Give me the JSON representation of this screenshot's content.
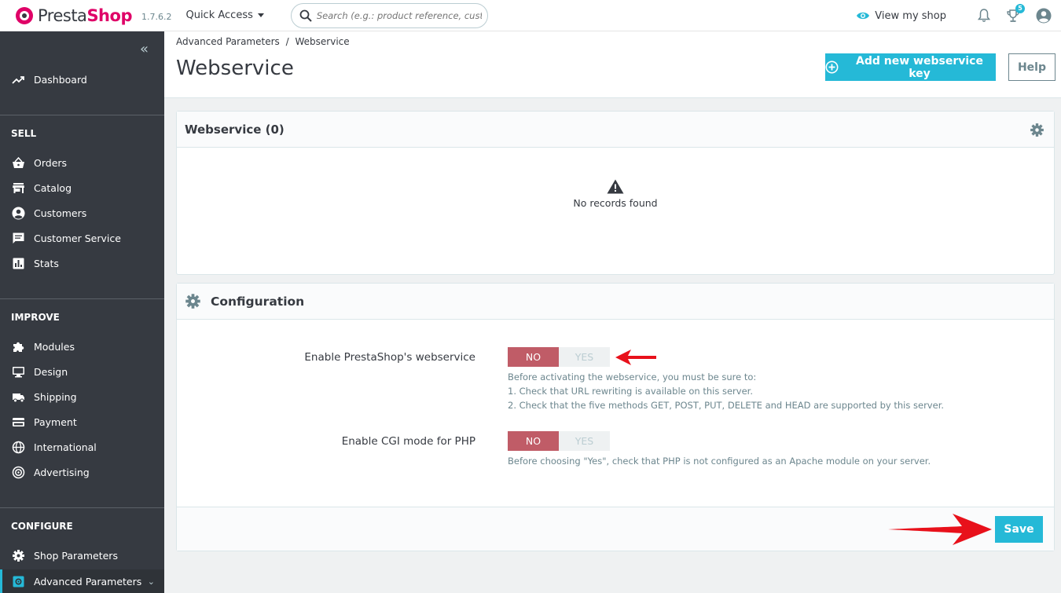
{
  "topbar": {
    "logo_prefix": "Presta",
    "logo_suffix": "Shop",
    "version": "1.7.6.2",
    "quick_access": "Quick Access",
    "search_placeholder": "Search (e.g.: product reference, custome",
    "view_my_shop": "View my shop",
    "notifications_badge": "5"
  },
  "sidebar": {
    "dashboard": "Dashboard",
    "sell_title": "SELL",
    "sell": [
      "Orders",
      "Catalog",
      "Customers",
      "Customer Service",
      "Stats"
    ],
    "improve_title": "IMPROVE",
    "improve": [
      "Modules",
      "Design",
      "Shipping",
      "Payment",
      "International",
      "Advertising"
    ],
    "configure_title": "CONFIGURE",
    "configure": [
      "Shop Parameters",
      "Advanced Parameters"
    ]
  },
  "header": {
    "breadcrumb_parent": "Advanced Parameters",
    "breadcrumb_separator": "/",
    "breadcrumb_current": "Webservice",
    "title": "Webservice",
    "add_button": "Add new webservice key",
    "help_button": "Help"
  },
  "list_panel": {
    "title": "Webservice (0)",
    "empty_text": "No records found"
  },
  "config_panel": {
    "title": "Configuration",
    "webservice_label": "Enable PrestaShop's webservice",
    "webservice_no": "NO",
    "webservice_yes": "YES",
    "webservice_help": [
      "Before activating the webservice, you must be sure to:",
      "1. Check that URL rewriting is available on this server.",
      "2. Check that the five methods GET, POST, PUT, DELETE and HEAD are supported by this server."
    ],
    "cgi_label": "Enable CGI mode for PHP",
    "cgi_no": "NO",
    "cgi_yes": "YES",
    "cgi_help": "Before choosing \"Yes\", check that PHP is not configured as an Apache module on your server.",
    "save_button": "Save"
  },
  "colors": {
    "accent": "#25b9d7",
    "brand": "#df0067",
    "switch_off_active": "#c05c67",
    "sidebar": "#363a41",
    "annotation_arrow": "#e8111b"
  }
}
